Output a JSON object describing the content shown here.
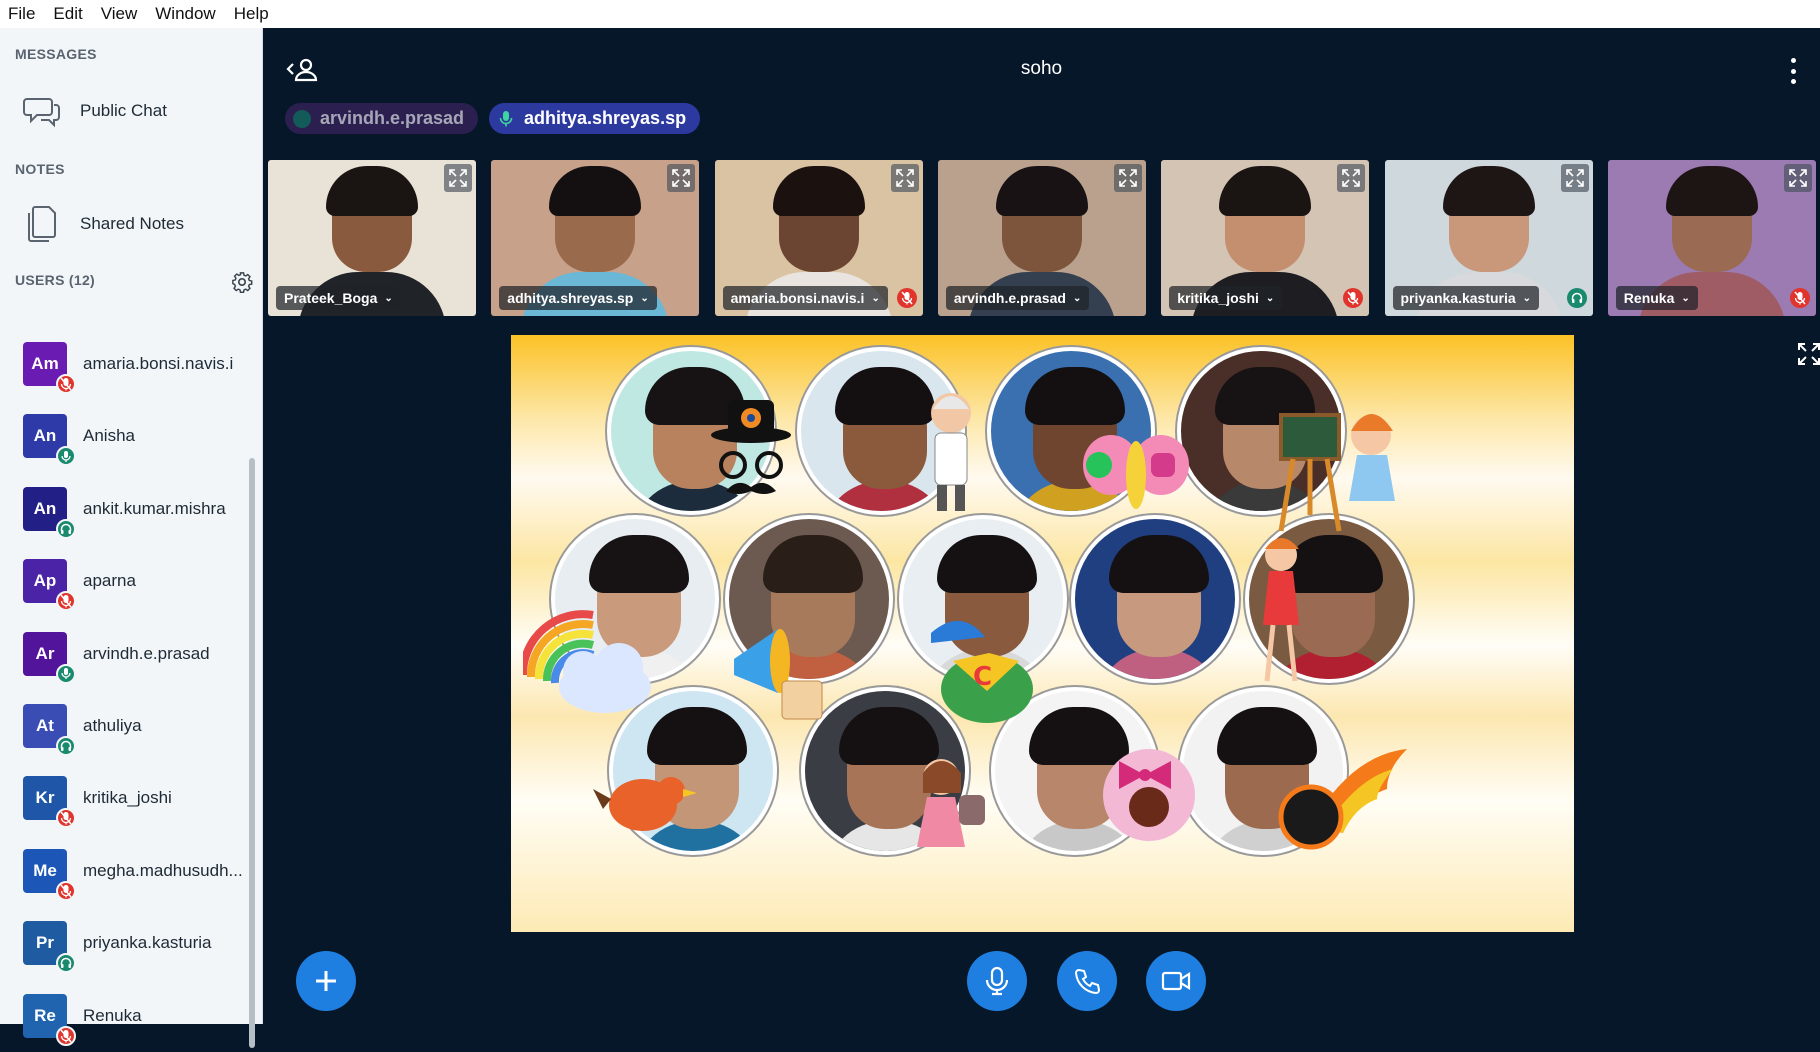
{
  "menu": [
    "File",
    "Edit",
    "View",
    "Window",
    "Help"
  ],
  "sidebar": {
    "messages_title": "MESSAGES",
    "public_chat": "Public Chat",
    "notes_title": "NOTES",
    "shared_notes": "Shared Notes",
    "users_title": "USERS (12)",
    "users": [
      {
        "initials": "Am",
        "name": "amaria.bonsi.navis.i",
        "color": "#6a1bb1",
        "status": "muted"
      },
      {
        "initials": "An",
        "name": "Anisha",
        "color": "#2d3aa8",
        "status": "mic"
      },
      {
        "initials": "An",
        "name": "ankit.kumar.mishra",
        "color": "#221f86",
        "status": "listen"
      },
      {
        "initials": "Ap",
        "name": "aparna",
        "color": "#4a23a6",
        "status": "muted"
      },
      {
        "initials": "Ar",
        "name": "arvindh.e.prasad",
        "color": "#51149a",
        "status": "mic"
      },
      {
        "initials": "At",
        "name": "athuliya",
        "color": "#3a4db5",
        "status": "listen"
      },
      {
        "initials": "Kr",
        "name": "kritika_joshi",
        "color": "#1f56a8",
        "status": "muted"
      },
      {
        "initials": "Me",
        "name": "megha.madhusudh...",
        "color": "#1c56b6",
        "status": "muted"
      },
      {
        "initials": "Pr",
        "name": "priyanka.kasturia",
        "color": "#1e5ba0",
        "status": "listen"
      },
      {
        "initials": "Re",
        "name": "Renuka",
        "color": "#2064b0",
        "status": "muted"
      }
    ]
  },
  "main": {
    "title": "soho",
    "talkers": [
      {
        "name": "arvindh.e.prasad",
        "active": false
      },
      {
        "name": "adhitya.shreyas.sp",
        "active": true
      }
    ],
    "tiles": [
      {
        "name": "Prateek_Boga",
        "bg": "#e9e2d6",
        "skin": "#8a5a3e",
        "hair": "#1a1412",
        "shirt": "#202428",
        "badge": "none"
      },
      {
        "name": "adhitya.shreyas.sp",
        "bg": "#c8a18a",
        "skin": "#9a6a4c",
        "hair": "#141012",
        "shirt": "#6bb7d6",
        "badge": "none"
      },
      {
        "name": "amaria.bonsi.navis.i",
        "bg": "#d9c3a3",
        "skin": "#6b4532",
        "hair": "#1b1210",
        "shirt": "#e9e4df",
        "badge": "muted"
      },
      {
        "name": "arvindh.e.prasad",
        "bg": "#b9a18e",
        "skin": "#7d553d",
        "hair": "#181214",
        "shirt": "#344050",
        "badge": "none"
      },
      {
        "name": "kritika_joshi",
        "bg": "#d4c4b4",
        "skin": "#c48f6e",
        "hair": "#1a1412",
        "shirt": "#1e1e22",
        "badge": "muted"
      },
      {
        "name": "priyanka.kasturia",
        "bg": "#cfd8dc",
        "skin": "#c9977a",
        "hair": "#1e1614",
        "shirt": "#d7d9dc",
        "badge": "listen"
      },
      {
        "name": "Renuka",
        "bg": "#9c7bb3",
        "skin": "#9a6a52",
        "hair": "#1d1414",
        "shirt": "#a05c64",
        "badge": "muted"
      }
    ],
    "share_circles": [
      {
        "skin": "#b8825f",
        "hair": "#171314",
        "bg": "#bfe8e2",
        "shirt": "#1c2c3c"
      },
      {
        "skin": "#8b5a3c",
        "hair": "#141012",
        "bg": "#d9e6ee",
        "shirt": "#b03040"
      },
      {
        "skin": "#70452f",
        "hair": "#141012",
        "bg": "#3a6fb0",
        "shirt": "#d0a020"
      },
      {
        "skin": "#b8886a",
        "hair": "#171214",
        "bg": "#4a2f28",
        "shirt": "#3a3a3a"
      },
      {
        "skin": "#c99a7c",
        "hair": "#171214",
        "bg": "#e7edf1",
        "shirt": "#f0f0f0"
      },
      {
        "skin": "#a87a5c",
        "hair": "#2a1e18",
        "bg": "#6c5a50",
        "shirt": "#c06040"
      },
      {
        "skin": "#8a5a3e",
        "hair": "#151112",
        "bg": "#e8eef2",
        "shirt": "#d9d9d9"
      },
      {
        "skin": "#c79a80",
        "hair": "#151112",
        "bg": "#203f80",
        "shirt": "#c06080"
      },
      {
        "skin": "#9a6a52",
        "hair": "#151112",
        "bg": "#7a5a40",
        "shirt": "#b02030"
      },
      {
        "skin": "#c49678",
        "hair": "#151112",
        "bg": "#cde6f2",
        "shirt": "#2070a0"
      },
      {
        "skin": "#a87458",
        "hair": "#151112",
        "bg": "#3a3e44",
        "shirt": "#e6e6e6"
      },
      {
        "skin": "#b8866a",
        "hair": "#151112",
        "bg": "#f4f4f4",
        "shirt": "#c8c8c8"
      },
      {
        "skin": "#9c6a4e",
        "hair": "#151112",
        "bg": "#f2f2f2",
        "shirt": "#d0d0d0"
      }
    ]
  },
  "colors": {
    "accent": "#1e7fe0",
    "muted": "#e0342c",
    "listen": "#1a8a6e",
    "mic": "#1a8a6e"
  }
}
